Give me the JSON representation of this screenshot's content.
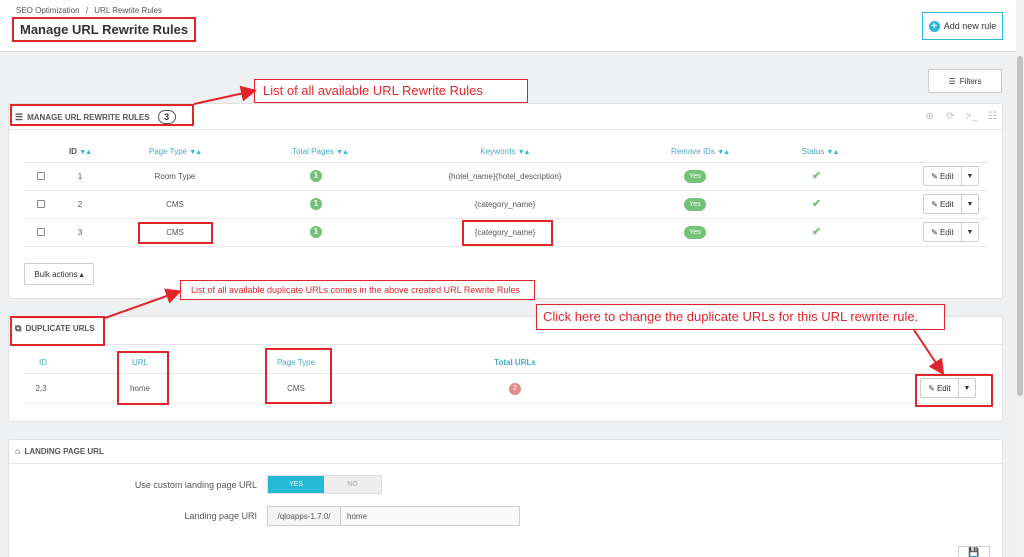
{
  "breadcrumb": {
    "parent": "SEO Optimization",
    "separator": "/",
    "current": "URL Rewrite Rules"
  },
  "page_title": "Manage URL Rewrite Rules",
  "add_rule_label": "Add new rule",
  "filters_label": "Filters",
  "rules_panel": {
    "title": "MANAGE URL REWRITE RULES",
    "count": "3",
    "columns": [
      "ID",
      "Page Type",
      "Total Pages",
      "Keywords",
      "Remove IDs",
      "Status"
    ],
    "rows": [
      {
        "id": "1",
        "page_type": "Room Type",
        "total_pages": "1",
        "keywords": "{hotel_name}{hotel_description}",
        "remove_ids": "Yes",
        "status": "✔",
        "edit": "Edit"
      },
      {
        "id": "2",
        "page_type": "CMS",
        "total_pages": "1",
        "keywords": "{category_name}",
        "remove_ids": "Yes",
        "status": "✔",
        "edit": "Edit"
      },
      {
        "id": "3",
        "page_type": "CMS",
        "total_pages": "1",
        "keywords": "{category_name}",
        "remove_ids": "Yes",
        "status": "✔",
        "edit": "Edit"
      }
    ],
    "bulk_actions": "Bulk actions ▴"
  },
  "duplicate_panel": {
    "title": "DUPLICATE URLS",
    "columns": [
      "ID",
      "URL",
      "Page Type",
      "Total URLs"
    ],
    "rows": [
      {
        "id": "2,3",
        "url": "home",
        "page_type": "CMS",
        "total_urls": "2",
        "edit": "Edit"
      }
    ]
  },
  "landing_panel": {
    "title": "LANDING PAGE URL",
    "custom_label": "Use custom landing page URL",
    "yes_label": "YES",
    "no_label": "NO",
    "uri_label": "Landing page URI",
    "uri_prefix": "/qloapps-1.7.0/",
    "uri_value": "home"
  },
  "annotations": {
    "list_rules": "List of all available URL Rewrite Rules",
    "list_duplicates": "List of all available duplicate URLs comes in the above created URL Rewrite Rules",
    "change_duplicates": "Click here to change the duplicate URLs for this URL rewrite rule."
  },
  "colors": {
    "accent": "#25b9d7",
    "success": "#72c279",
    "annotation": "#e0262a"
  }
}
